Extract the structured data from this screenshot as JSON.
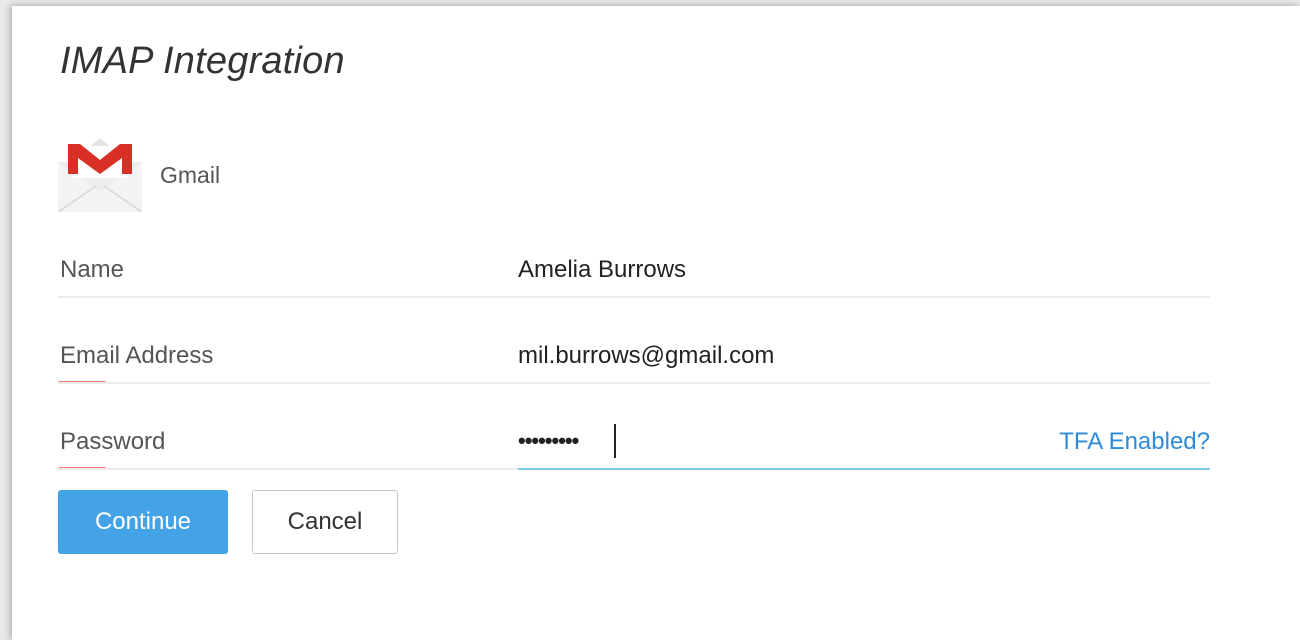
{
  "dialog": {
    "title": "IMAP Integration"
  },
  "provider": {
    "icon": "gmail-icon",
    "label": "Gmail",
    "brand_color": "#d93025"
  },
  "form": {
    "name": {
      "label": "Name",
      "value": "Amelia Burrows"
    },
    "email": {
      "label": "Email Address",
      "value": "mil.burrows@gmail.com"
    },
    "password": {
      "label": "Password",
      "masked_value": "•••••••••",
      "tfa_link": "TFA Enabled?"
    }
  },
  "actions": {
    "continue_label": "Continue",
    "cancel_label": "Cancel"
  },
  "colors": {
    "accent": "#44a3e6",
    "link": "#2f8ad8",
    "required_marker": "#f27d7d",
    "focus_underline": "#7cc8ee"
  }
}
